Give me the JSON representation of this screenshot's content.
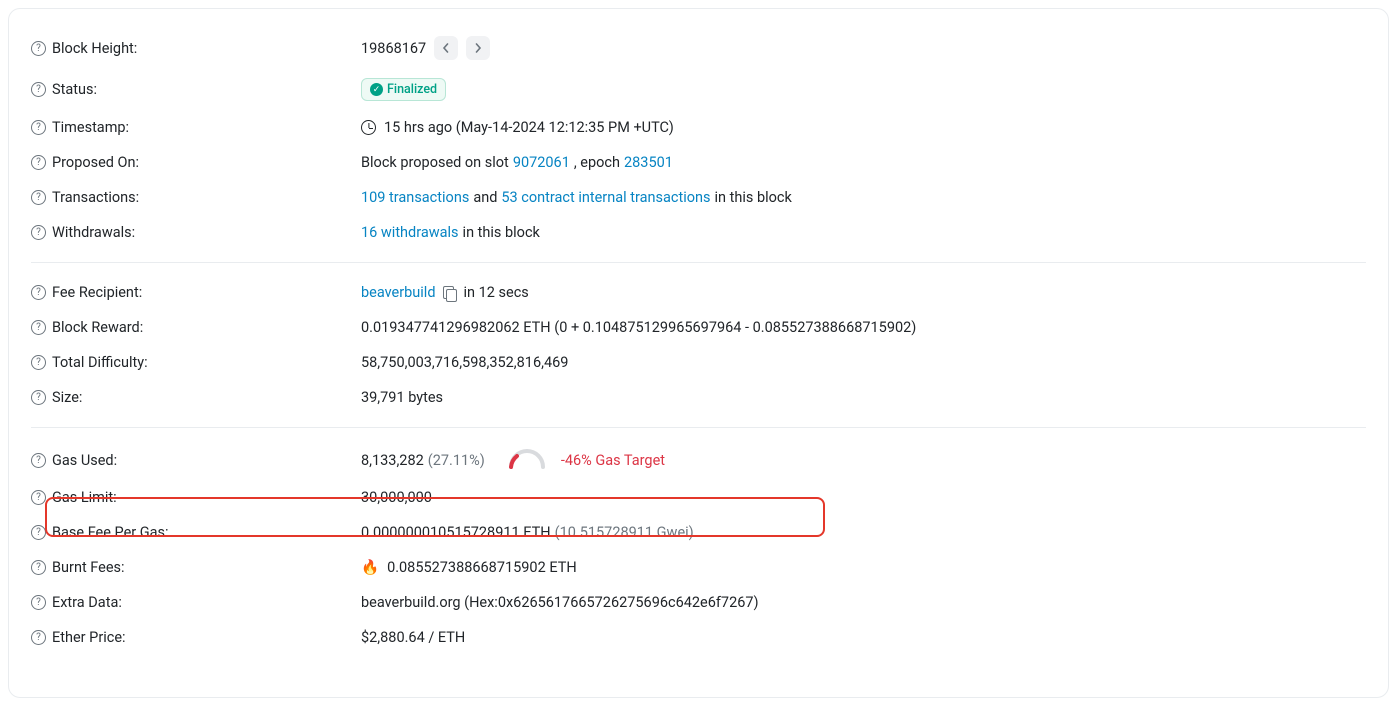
{
  "labels": {
    "block_height": "Block Height:",
    "status": "Status:",
    "timestamp": "Timestamp:",
    "proposed_on": "Proposed On:",
    "transactions": "Transactions:",
    "withdrawals": "Withdrawals:",
    "fee_recipient": "Fee Recipient:",
    "block_reward": "Block Reward:",
    "total_difficulty": "Total Difficulty:",
    "size": "Size:",
    "gas_used": "Gas Used:",
    "gas_limit": "Gas Limit:",
    "base_fee": "Base Fee Per Gas:",
    "burnt_fees": "Burnt Fees:",
    "extra_data": "Extra Data:",
    "ether_price": "Ether Price:"
  },
  "block_height": "19868167",
  "status": "Finalized",
  "timestamp": "15 hrs ago (May-14-2024 12:12:35 PM +UTC)",
  "proposed_on": {
    "prefix": "Block proposed on slot ",
    "slot": "9072061",
    "mid": ", epoch ",
    "epoch": "283501"
  },
  "transactions": {
    "tx_link": "109 transactions",
    "mid": " and ",
    "internal_link": "53 contract internal transactions",
    "suffix": " in this block"
  },
  "withdrawals": {
    "link": "16 withdrawals",
    "suffix": " in this block"
  },
  "fee_recipient": {
    "name": "beaverbuild",
    "suffix": " in 12 secs"
  },
  "block_reward": "0.019347741296982062 ETH (0 + 0.104875129965697964 - 0.085527388668715902)",
  "total_difficulty": "58,750,003,716,598,352,816,469",
  "size": "39,791 bytes",
  "gas_used": {
    "value": "8,133,282",
    "pct": "(27.11%)",
    "target": "-46% Gas Target"
  },
  "gas_limit": "30,000,000",
  "base_fee": {
    "eth": "0.000000010515728911 ETH ",
    "gwei": "(10.515728911 Gwei)"
  },
  "burnt_fees": "0.085527388668715902 ETH",
  "extra_data": "beaverbuild.org (Hex:0x6265617665726275696c642e6f7267)",
  "ether_price": "$2,880.64 / ETH"
}
